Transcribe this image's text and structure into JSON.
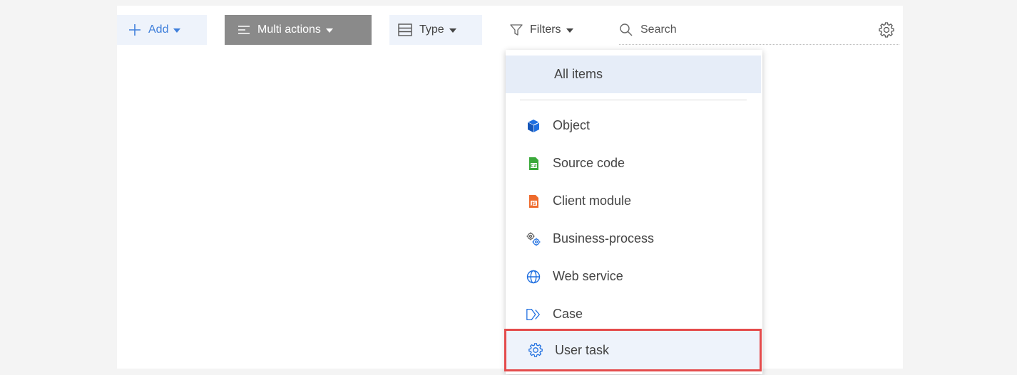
{
  "toolbar": {
    "add_label": "Add",
    "multi_actions_label": "Multi actions",
    "type_label": "Type",
    "filters_label": "Filters",
    "search_placeholder": "Search"
  },
  "type_menu": {
    "all_items_label": "All items",
    "items": [
      {
        "label": "Object",
        "icon": "cube-icon"
      },
      {
        "label": "Source code",
        "icon": "csharp-file-icon"
      },
      {
        "label": "Client module",
        "icon": "js-file-icon"
      },
      {
        "label": "Business-process",
        "icon": "gears-icon"
      },
      {
        "label": "Web service",
        "icon": "globe-icon"
      },
      {
        "label": "Case",
        "icon": "case-chevron-icon"
      },
      {
        "label": "User task",
        "icon": "gear-icon"
      }
    ],
    "selected": "User task"
  },
  "colors": {
    "accent_blue": "#3f7fdb",
    "multi_actions_bg": "#8a8a8a",
    "highlight_border": "#e44b4b",
    "source_code_green": "#3aa93a",
    "client_module_orange": "#ee6a2c"
  }
}
